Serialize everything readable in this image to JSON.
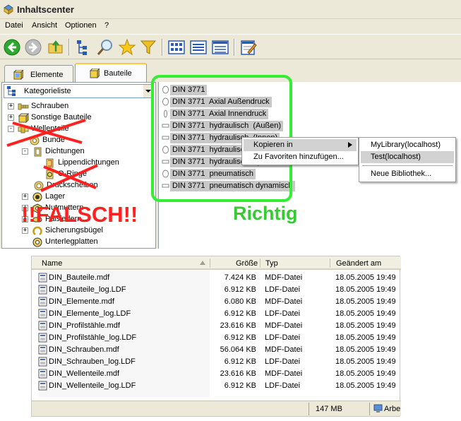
{
  "window": {
    "title": "Inhaltscenter"
  },
  "menu": [
    "Datei",
    "Ansicht",
    "Optionen",
    "?"
  ],
  "tabs": [
    {
      "label": "Elemente",
      "active": false
    },
    {
      "label": "Bauteile",
      "active": true
    }
  ],
  "category_selector": {
    "value": "Kategorieliste"
  },
  "tree": [
    {
      "label": "Schrauben",
      "expander": "+"
    },
    {
      "label": "Sonstige Bauteile",
      "expander": "+"
    },
    {
      "label": "Wellenteile",
      "expander": "-"
    },
    {
      "label": "Bunde",
      "expander": ""
    },
    {
      "label": "Dichtungen",
      "expander": "-"
    },
    {
      "label": "Lippendichtungen",
      "expander": ""
    },
    {
      "label": "O-Ringe",
      "expander": ""
    },
    {
      "label": "Druckscheiben",
      "expander": ""
    },
    {
      "label": "Lager",
      "expander": "+"
    },
    {
      "label": "Nutmuttern",
      "expander": "+"
    },
    {
      "label": "Paßfedern",
      "expander": "+"
    },
    {
      "label": "Sicherungsbügel",
      "expander": "+"
    },
    {
      "label": "Unterlegplatten",
      "expander": ""
    }
  ],
  "parts": [
    "DIN 3771",
    "DIN 3771  Axial Außendruck",
    "DIN 3771  Axial Innendruck",
    "DIN 3771  hydraulisch  (Außen)",
    "DIN 3771  hydraulisch  (Innen)",
    "DIN 3771  hydraulisch  statisch",
    "DIN 3771  hydraulisch  dynamisch",
    "DIN 3771  pneumatisch",
    "DIN 3771  pneumatisch dynamisch"
  ],
  "context_menu": {
    "items": [
      "Kopieren in",
      "Zu Favoriten hinzufügen..."
    ],
    "highlighted": 0
  },
  "submenu": {
    "items": [
      "MyLibrary(localhost)",
      "Test(localhost)",
      "Neue Bibliothek..."
    ],
    "highlighted": 1
  },
  "annotations": {
    "right": "Richtig",
    "wrong": "!!FALSCH!!"
  },
  "explorer": {
    "columns": [
      "Name",
      "Größe",
      "Typ",
      "Geändert am"
    ],
    "files": [
      {
        "name": "DIN_Bauteile.mdf",
        "size": "7.424 KB",
        "type": "MDF-Datei",
        "date": "18.05.2005 19:49"
      },
      {
        "name": "DIN_Bauteile_log.LDF",
        "size": "6.912 KB",
        "type": "LDF-Datei",
        "date": "18.05.2005 19:49"
      },
      {
        "name": "DIN_Elemente.mdf",
        "size": "6.080 KB",
        "type": "MDF-Datei",
        "date": "18.05.2005 19:49"
      },
      {
        "name": "DIN_Elemente_log.LDF",
        "size": "6.912 KB",
        "type": "LDF-Datei",
        "date": "18.05.2005 19:49"
      },
      {
        "name": "DIN_Profilstähle.mdf",
        "size": "23.616 KB",
        "type": "MDF-Datei",
        "date": "18.05.2005 19:49"
      },
      {
        "name": "DIN_Profilstähle_log.LDF",
        "size": "6.912 KB",
        "type": "LDF-Datei",
        "date": "18.05.2005 19:49"
      },
      {
        "name": "DIN_Schrauben.mdf",
        "size": "56.064 KB",
        "type": "MDF-Datei",
        "date": "18.05.2005 19:49"
      },
      {
        "name": "DIN_Schrauben_log.LDF",
        "size": "6.912 KB",
        "type": "LDF-Datei",
        "date": "18.05.2005 19:49"
      },
      {
        "name": "DIN_Wellenteile.mdf",
        "size": "23.616 KB",
        "type": "MDF-Datei",
        "date": "18.05.2005 19:49"
      },
      {
        "name": "DIN_Wellenteile_log.LDF",
        "size": "6.912 KB",
        "type": "LDF-Datei",
        "date": "18.05.2005 19:49"
      }
    ],
    "status": {
      "size": "147 MB",
      "location": "Arbe"
    }
  },
  "colors": {
    "green_highlight": "#33ee33",
    "red_annotation": "#ff2020",
    "selection_gray": "#c8c8c8"
  }
}
